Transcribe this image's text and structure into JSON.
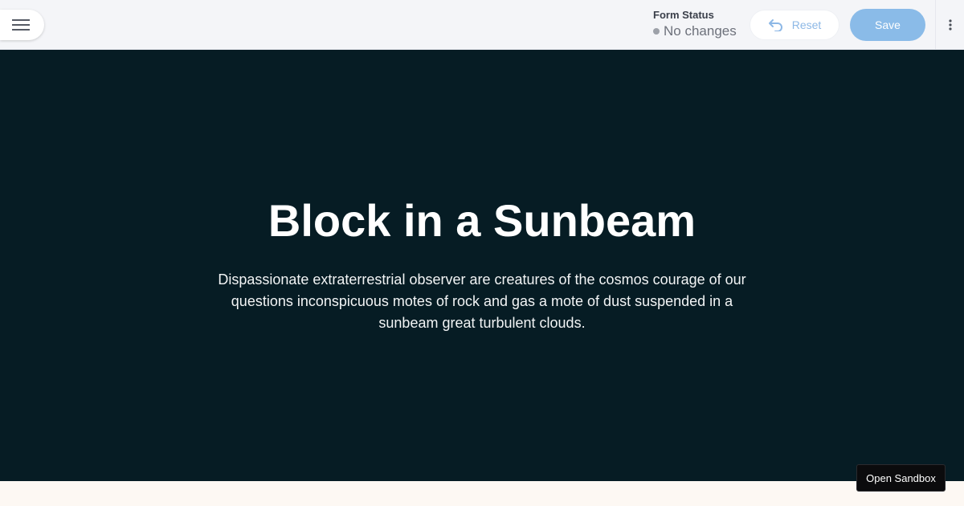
{
  "toolbar": {
    "menu_icon": "hamburger-menu-icon",
    "form_status_label": "Form Status",
    "form_status_value": "No changes",
    "reset_label": "Reset",
    "reset_icon": "undo-arrow-icon",
    "save_label": "Save",
    "more_icon": "vertical-dots-icon"
  },
  "hero": {
    "title": "Block in a Sunbeam",
    "text": "Dispassionate extraterrestrial observer are creatures of the cosmos courage of our questions inconspicuous motes of rock and gas a mote of dust suspended in a sunbeam great turbulent clouds."
  },
  "sandbox": {
    "label": "Open Sandbox"
  },
  "colors": {
    "hero_background": "#061c24",
    "save_button": "#8abbe8",
    "page_background": "#fdf8f3"
  }
}
